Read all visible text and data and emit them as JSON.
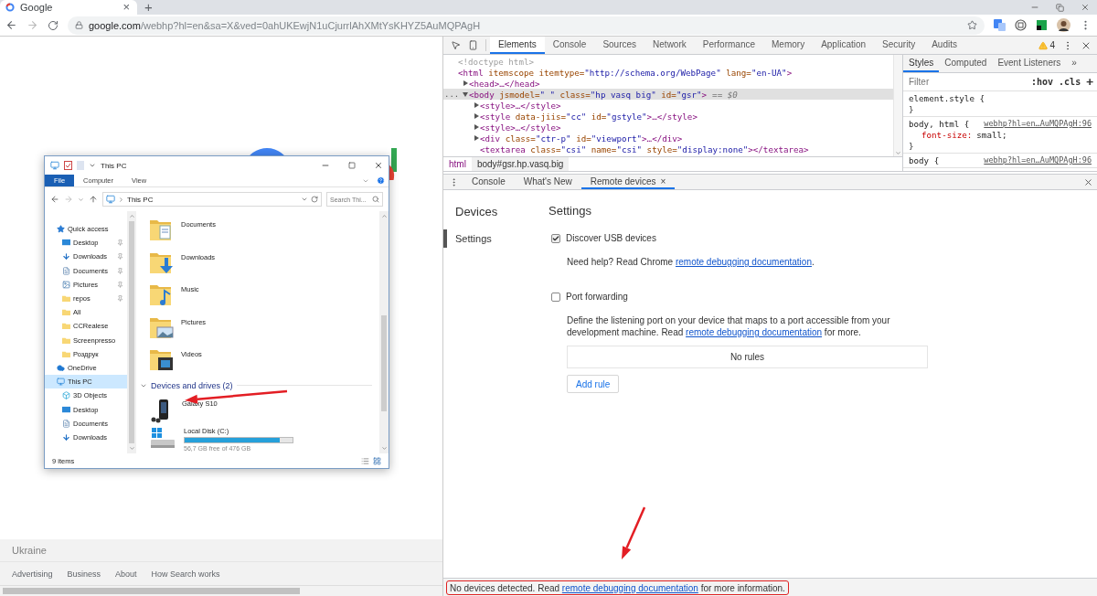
{
  "browser": {
    "tab": {
      "title": "Google",
      "close": "×"
    },
    "new_tab": "+",
    "address": {
      "host": "google.com",
      "path": "/webhp?hl=en&sa=X&ved=0ahUKEwjN1uCjurrlAhXMtYsKHYZ5AuMQPAgH"
    }
  },
  "google_page": {
    "country": "Ukraine",
    "footer_links": [
      "Advertising",
      "Business",
      "About",
      "How Search works"
    ]
  },
  "explorer": {
    "title": "This PC",
    "ribbon_tabs": [
      {
        "label": "File",
        "selected": true
      },
      {
        "label": "Computer",
        "selected": false
      },
      {
        "label": "View",
        "selected": false
      }
    ],
    "address": "This PC",
    "search": {
      "placeholder": "Search Thi..."
    },
    "nav": [
      {
        "label": "Quick access",
        "kind": "star",
        "selected": false,
        "children": [
          {
            "label": "Desktop",
            "kind": "desktop",
            "pinned": true,
            "selected": false
          },
          {
            "label": "Downloads",
            "kind": "downloads",
            "pinned": true,
            "selected": false
          },
          {
            "label": "Documents",
            "kind": "documents",
            "pinned": true,
            "selected": false
          },
          {
            "label": "Pictures",
            "kind": "pictures",
            "pinned": true,
            "selected": false
          },
          {
            "label": "repos",
            "kind": "folder",
            "pinned": true,
            "selected": false
          },
          {
            "label": "All",
            "kind": "folder",
            "pinned": false,
            "selected": false
          },
          {
            "label": "CCRealese",
            "kind": "folder",
            "pinned": false,
            "selected": false
          },
          {
            "label": "Screenpresso",
            "kind": "folder",
            "pinned": false,
            "selected": false
          },
          {
            "label": "Роздрук",
            "kind": "folder",
            "pinned": false,
            "selected": false
          }
        ]
      },
      {
        "label": "OneDrive",
        "kind": "cloud",
        "selected": false
      },
      {
        "label": "This PC",
        "kind": "pc",
        "selected": true,
        "children": [
          {
            "label": "3D Objects",
            "kind": "objects",
            "pinned": false,
            "selected": false
          },
          {
            "label": "Desktop",
            "kind": "desktop",
            "pinned": false,
            "selected": false
          },
          {
            "label": "Documents",
            "kind": "documents",
            "pinned": false,
            "selected": false
          },
          {
            "label": "Downloads",
            "kind": "downloads",
            "pinned": false,
            "selected": false
          }
        ]
      }
    ],
    "folders": [
      {
        "label": "Documents",
        "kind": "documents"
      },
      {
        "label": "Downloads",
        "kind": "downloads"
      },
      {
        "label": "Music",
        "kind": "music"
      },
      {
        "label": "Pictures",
        "kind": "pictures"
      },
      {
        "label": "Videos",
        "kind": "videos"
      }
    ],
    "group": {
      "label": "Devices and drives (2)",
      "expanded": true
    },
    "devices": [
      {
        "label": "Galaxy S10",
        "kind": "phone"
      },
      {
        "label": "Local Disk (C:)",
        "kind": "disk",
        "level": 0.88,
        "caption": "56,7 GB free of 476 GB"
      }
    ],
    "status": "9 items"
  },
  "devtools": {
    "panel_tabs": [
      {
        "label": "Elements",
        "selected": true
      },
      {
        "label": "Console",
        "selected": false
      },
      {
        "label": "Sources",
        "selected": false
      },
      {
        "label": "Network",
        "selected": false
      },
      {
        "label": "Performance",
        "selected": false
      },
      {
        "label": "Memory",
        "selected": false
      },
      {
        "label": "Application",
        "selected": false
      },
      {
        "label": "Security",
        "selected": false
      },
      {
        "label": "Audits",
        "selected": false
      }
    ],
    "warnings": "4",
    "dom": [
      {
        "text": "<!doctype html>",
        "kind": "doctype",
        "selected": false
      },
      {
        "text": "<html itemscope itemtype=\"http://schema.org/WebPage\" lang=\"en-UA\">",
        "kind": "element",
        "selected": false,
        "children": [
          {
            "text": "<head>…</head>",
            "kind": "element",
            "selected": false,
            "expanded": false
          },
          {
            "text": "<body jsmodel=\" \" class=\"hp vasq big\" id=\"gsr\">",
            "kind": "element",
            "selected": true,
            "expanded": true,
            "gutter": "...",
            "suffix": "== $0",
            "children": [
              {
                "text": "<style>…</style>",
                "kind": "element",
                "selected": false,
                "expanded": false
              },
              {
                "text": "<style data-jiis=\"cc\" id=\"gstyle\">…</style>",
                "kind": "element",
                "selected": false,
                "expanded": false
              },
              {
                "text": "<style>…</style>",
                "kind": "element",
                "selected": false,
                "expanded": false
              },
              {
                "text": "<div class=\"ctr-p\" id=\"viewport\">…</div>",
                "kind": "element",
                "selected": false,
                "expanded": false
              },
              {
                "text": "<textarea class=\"csi\" name=\"csi\" style=\"display:none\"></textarea>",
                "kind": "element",
                "selected": false
              }
            ]
          }
        ]
      }
    ],
    "breadcrumbs": [
      {
        "label": "html",
        "selected": false
      },
      {
        "label": "body#gsr.hp.vasq.big",
        "selected": true
      }
    ],
    "styles": {
      "tabs": [
        {
          "label": "Styles",
          "selected": true
        },
        {
          "label": "Computed",
          "selected": false
        },
        {
          "label": "Event Listeners",
          "selected": false
        }
      ],
      "more": "»",
      "filter": {
        "placeholder": "Filter"
      },
      "hov": ":hov",
      "cls": ".cls",
      "add": "+",
      "rules": [
        {
          "selector": "element.style {",
          "close": "}"
        },
        {
          "selector": "body, html {",
          "source": "webhp?hl=en…AuMQPAgH:96",
          "declarations": [
            {
              "property": "font-size:",
              "value": "small;"
            }
          ],
          "close": "}"
        },
        {
          "selector": "body {",
          "source": "webhp?hl=en…AuMQPAgH:96"
        }
      ]
    },
    "drawer_tabs": [
      {
        "label": "Console",
        "selected": false
      },
      {
        "label": "What's New",
        "selected": false
      },
      {
        "label": "Remote devices",
        "selected": true,
        "close": "×"
      }
    ]
  },
  "remote_devices": {
    "sidebar_title": "Devices",
    "sidebar_items": [
      {
        "label": "Settings",
        "selected": true
      }
    ],
    "heading": "Settings",
    "options": [
      {
        "label": "Discover USB devices",
        "checked": true,
        "note": {
          "before": "Need help? Read Chrome ",
          "link": "remote debugging documentation",
          "after": "."
        }
      },
      {
        "label": "Port forwarding",
        "checked": false,
        "note": {
          "before": "Define the listening port on your device that maps to a port accessible from your development machine. Read ",
          "link": "remote debugging documentation",
          "after": " for more."
        },
        "rules_table": {
          "empty": "No rules"
        },
        "button": "Add rule"
      }
    ]
  },
  "status_bar": {
    "before": "No devices detected. Read ",
    "link": "remote debugging documentation",
    "after": " for more information."
  }
}
